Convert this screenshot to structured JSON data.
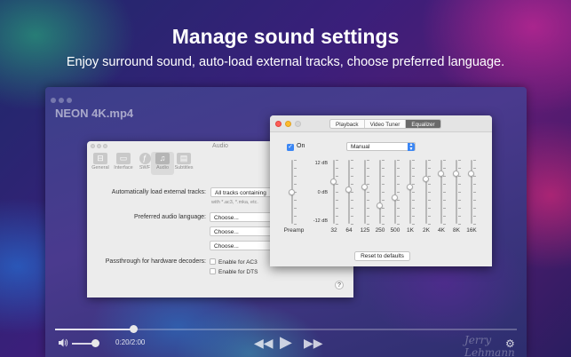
{
  "hero": {
    "headline": "Manage sound settings",
    "subline": "Enjoy surround sound, auto-load external tracks, choose preferred language."
  },
  "player": {
    "title": "NEON 4K.mp4",
    "time": "0:20/2:00",
    "progress": 0.17,
    "volume": 0.85,
    "signature": "Jerry Lehmann"
  },
  "audio_prefs": {
    "window_title": "Audio",
    "toolbar": [
      {
        "label": "General",
        "icon": "switch-icon"
      },
      {
        "label": "Interface",
        "icon": "interface-icon"
      },
      {
        "label": "SWF",
        "icon": "swf-icon"
      },
      {
        "label": "Audio",
        "icon": "music-note-icon"
      },
      {
        "label": "Subtitles",
        "icon": "subtitles-icon"
      }
    ],
    "auto_load_label": "Automatically load external tracks:",
    "auto_load_value": "All tracks containing",
    "auto_load_hint": "with *.ac3, *.mka, etc.",
    "preferred_language_label": "Preferred audio language:",
    "language_choices": [
      "Choose...",
      "Choose...",
      "Choose..."
    ],
    "passthrough_label": "Passthrough for hardware decoders:",
    "enable_ac3": "Enable for AC3",
    "enable_dts": "Enable for DTS",
    "help": "?"
  },
  "equalizer": {
    "tabs": [
      "Playback",
      "Video Tuner",
      "Equalizer"
    ],
    "selected_tab": "Equalizer",
    "on_label": "On",
    "on_checked": true,
    "preset": "Manual",
    "db_max": "12 dB",
    "db_mid": "0 dB",
    "db_min": "-12 dB",
    "preamp_label": "Preamp",
    "reset_label": "Reset to defaults",
    "bands": [
      {
        "label": "Preamp",
        "gain": 0
      },
      {
        "label": "32",
        "gain": 4
      },
      {
        "label": "64",
        "gain": 1
      },
      {
        "label": "125",
        "gain": 2
      },
      {
        "label": "250",
        "gain": -5
      },
      {
        "label": "500",
        "gain": -2
      },
      {
        "label": "1K",
        "gain": 2
      },
      {
        "label": "2K",
        "gain": 5
      },
      {
        "label": "4K",
        "gain": 7
      },
      {
        "label": "8K",
        "gain": 7
      },
      {
        "label": "16K",
        "gain": 7
      }
    ],
    "accent_color": "#3b86f4"
  }
}
